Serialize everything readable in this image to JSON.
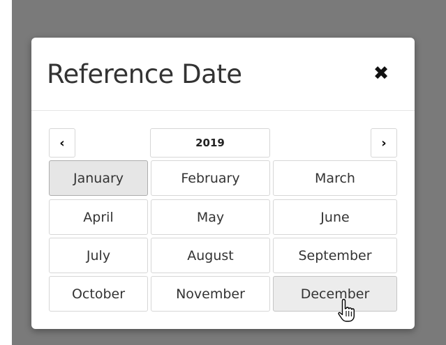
{
  "dialog": {
    "title": "Reference Date",
    "close_icon": "close-icon",
    "close_glyph": "✖"
  },
  "calendar": {
    "year": "2019",
    "prev_icon": "chevron-left-icon",
    "prev_glyph": "‹",
    "next_icon": "chevron-right-icon",
    "next_glyph": "›",
    "months": [
      "January",
      "February",
      "March",
      "April",
      "May",
      "June",
      "July",
      "August",
      "September",
      "October",
      "November",
      "December"
    ],
    "selected_month": "January",
    "hovered_month": "December"
  },
  "cursor": {
    "icon": "hand-pointer-icon"
  },
  "colors": {
    "backdrop": "#7a7a7a",
    "selected_bg": "#e6e6e6",
    "hover_bg": "#ececec",
    "border": "#d6d6d6"
  }
}
